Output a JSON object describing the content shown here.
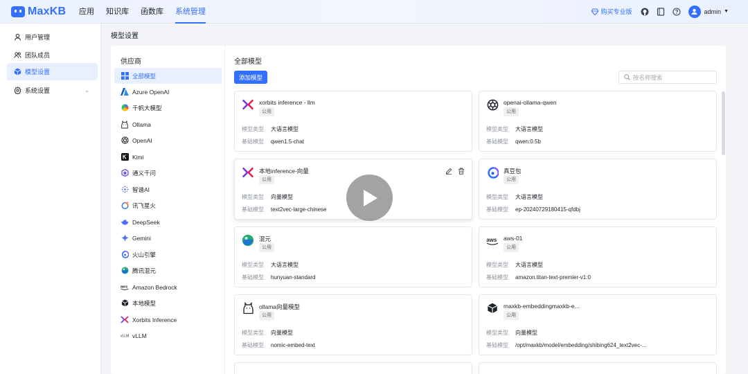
{
  "app": {
    "name": "MaxKB"
  },
  "nav": [
    {
      "label": "应用",
      "active": false
    },
    {
      "label": "知识库",
      "active": false
    },
    {
      "label": "函数库",
      "active": false
    },
    {
      "label": "系统管理",
      "active": true
    }
  ],
  "topbar": {
    "pro_label": "购买专业版",
    "username": "admin"
  },
  "sidebar": [
    {
      "label": "用户管理",
      "icon": "user-icon",
      "active": false
    },
    {
      "label": "团队成员",
      "icon": "team-icon",
      "active": false
    },
    {
      "label": "模型设置",
      "icon": "model-cube-icon",
      "active": true
    },
    {
      "label": "系统设置",
      "icon": "settings-gear-icon",
      "active": false,
      "expandable": true
    }
  ],
  "page": {
    "title": "模型设置"
  },
  "providers": {
    "title": "供应商",
    "items": [
      {
        "label": "全部模型",
        "icon": "grid-icon",
        "active": true
      },
      {
        "label": "Azure OpenAI",
        "icon": "azure-icon"
      },
      {
        "label": "千帆大模型",
        "icon": "qianfan-icon"
      },
      {
        "label": "Ollama",
        "icon": "ollama-icon"
      },
      {
        "label": "OpenAI",
        "icon": "openai-icon"
      },
      {
        "label": "Kimi",
        "icon": "kimi-icon"
      },
      {
        "label": "通义千问",
        "icon": "tongyi-icon"
      },
      {
        "label": "智谱AI",
        "icon": "zhipu-icon"
      },
      {
        "label": "讯飞星火",
        "icon": "xunfei-icon"
      },
      {
        "label": "DeepSeek",
        "icon": "deepseek-icon"
      },
      {
        "label": "Gemini",
        "icon": "gemini-icon"
      },
      {
        "label": "火山引擎",
        "icon": "volcano-icon"
      },
      {
        "label": "腾讯混元",
        "icon": "hunyuan-icon"
      },
      {
        "label": "Amazon Bedrock",
        "icon": "aws-icon"
      },
      {
        "label": "本地模型",
        "icon": "local-cube-icon"
      },
      {
        "label": "Xorbits Inference",
        "icon": "xorbits-icon"
      },
      {
        "label": "vLLM",
        "icon": "vllm-icon"
      }
    ]
  },
  "models": {
    "title": "全部模型",
    "add_label": "添加模型",
    "search_placeholder": "按名称搜索",
    "type_key": "模型类型",
    "base_key": "基础模型",
    "cards": [
      {
        "name": "xorbits inference - llm",
        "badge": "公用",
        "type": "大语言模型",
        "base": "qwen1.5-chat",
        "icon": "xorbits-icon"
      },
      {
        "name": "openai-ollama-qwen",
        "badge": "公用",
        "type": "大语言模型",
        "base": "qwen:0.5b",
        "icon": "openai-icon"
      },
      {
        "name": "本地inference-向量",
        "badge": "公用",
        "type": "向量模型",
        "base": "text2vec-large-chinese",
        "icon": "xorbits-icon",
        "hover": true
      },
      {
        "name": "真豆包",
        "badge": "公用",
        "type": "大语言模型",
        "base": "ep-20240729180415-qfdbj",
        "icon": "volcano-icon"
      },
      {
        "name": "混元",
        "badge": "公用",
        "type": "大语言模型",
        "base": "hunyuan-standard",
        "icon": "hunyuan-icon"
      },
      {
        "name": "aws-01",
        "badge": "公用",
        "type": "大语言模型",
        "base": "amazon.titan-text-premier-v1:0",
        "icon": "aws-icon"
      },
      {
        "name": "ollama向量模型",
        "badge": "公用",
        "type": "向量模型",
        "base": "nomic-embed-text",
        "icon": "ollama-icon"
      },
      {
        "name": "maxkb-embeddingmaxkb-e...",
        "badge": "公用",
        "type": "向量模型",
        "base": "/opt/maxkb/model/embedding/shibing624_text2vec-...",
        "icon": "local-cube-icon"
      }
    ]
  },
  "colors": {
    "accent": "#3370ff",
    "active_bg": "#e8efff"
  }
}
